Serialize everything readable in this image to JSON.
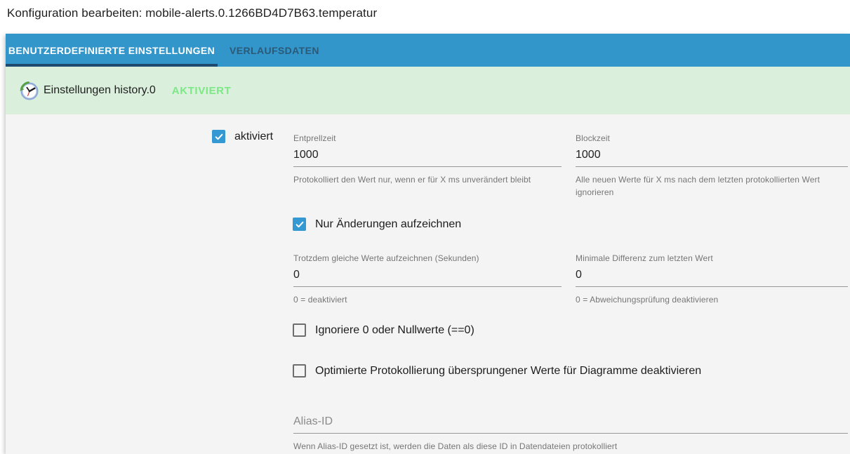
{
  "title": "Konfiguration bearbeiten: mobile-alerts.0.1266BD4D7B63.temperatur",
  "tabs": {
    "custom_settings": {
      "label": "BENUTZERDEFINIERTE EINSTELLUNGEN",
      "active": true
    },
    "history_data": {
      "label": "VERLAUFSDATEN",
      "active": false
    }
  },
  "banner": {
    "icon": "history-clock-icon",
    "title": "Einstellungen history.0",
    "status": "AKTIVIERT"
  },
  "form": {
    "enabled": {
      "label": "aktiviert",
      "checked": true
    },
    "fields": {
      "debounce": {
        "label": "Entprellzeit",
        "value": "1000",
        "helper": "Protokolliert den Wert nur, wenn er für X ms unverändert bleibt"
      },
      "blocktime": {
        "label": "Blockzeit",
        "value": "1000",
        "helper": "Alle neuen Werte für X ms nach dem letzten protokollierten Wert ignorieren"
      },
      "log_same_interval": {
        "label": "Trotzdem gleiche Werte aufzeichnen (Sekunden)",
        "value": "0",
        "helper": "0 = deaktiviert"
      },
      "min_difference": {
        "label": "Minimale Differenz zum letzten Wert",
        "value": "0",
        "helper": "0 = Abweichungsprüfung deaktivieren"
      },
      "alias_id": {
        "label": "Alias-ID",
        "value": "",
        "helper": "Wenn Alias-ID gesetzt ist, werden die Daten als diese ID in Datendateien protokolliert"
      }
    },
    "checkboxes": {
      "changes_only": {
        "label": "Nur Änderungen aufzeichnen",
        "checked": true
      },
      "ignore_zero": {
        "label": "Ignoriere 0 oder Nullwerte (==0)",
        "checked": false
      },
      "disable_optimized_logging": {
        "label": "Optimierte Protokollierung übersprungener Werte für Diagramme deaktivieren",
        "checked": false
      }
    }
  },
  "colors": {
    "tabbar_blue": "#3296cb",
    "active_tab_underline": "#1e4a70",
    "banner_green": "#daf0dc",
    "status_green": "#7ce885",
    "checkbox_blue": "#3498d3",
    "content_background": "#f4f4f4"
  }
}
